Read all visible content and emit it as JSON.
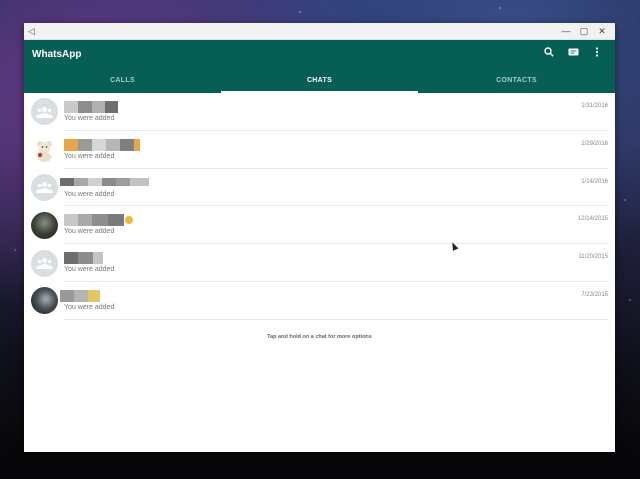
{
  "window": {
    "back_icon": "back-triangle-icon",
    "minimize_icon": "minimize-icon",
    "maximize_icon": "maximize-icon",
    "close_icon": "close-icon"
  },
  "app": {
    "title": "WhatsApp",
    "brand_color": "#075e54",
    "actions": [
      "search-icon",
      "new-chat-icon",
      "more-vert-icon"
    ]
  },
  "tabs": [
    {
      "label": "CALLS",
      "active": false
    },
    {
      "label": "CHATS",
      "active": true
    },
    {
      "label": "CONTACTS",
      "active": false
    }
  ],
  "chats": [
    {
      "avatar": "group-icon",
      "message": "You were added",
      "date": "1/31/2016"
    },
    {
      "avatar": "teddy-bear-photo",
      "message": "You were added",
      "date": "1/29/2016"
    },
    {
      "avatar": "group-icon",
      "message": "You were added",
      "date": "1/14/2016"
    },
    {
      "avatar": "profile-photo",
      "message": "You were added",
      "date": "12/14/2015"
    },
    {
      "avatar": "group-icon",
      "message": "You were added",
      "date": "11/20/2015"
    },
    {
      "avatar": "profile-photo",
      "message": "You were added",
      "date": "7/23/2015"
    }
  ],
  "hint": "Tap and hold on a chat for more options"
}
